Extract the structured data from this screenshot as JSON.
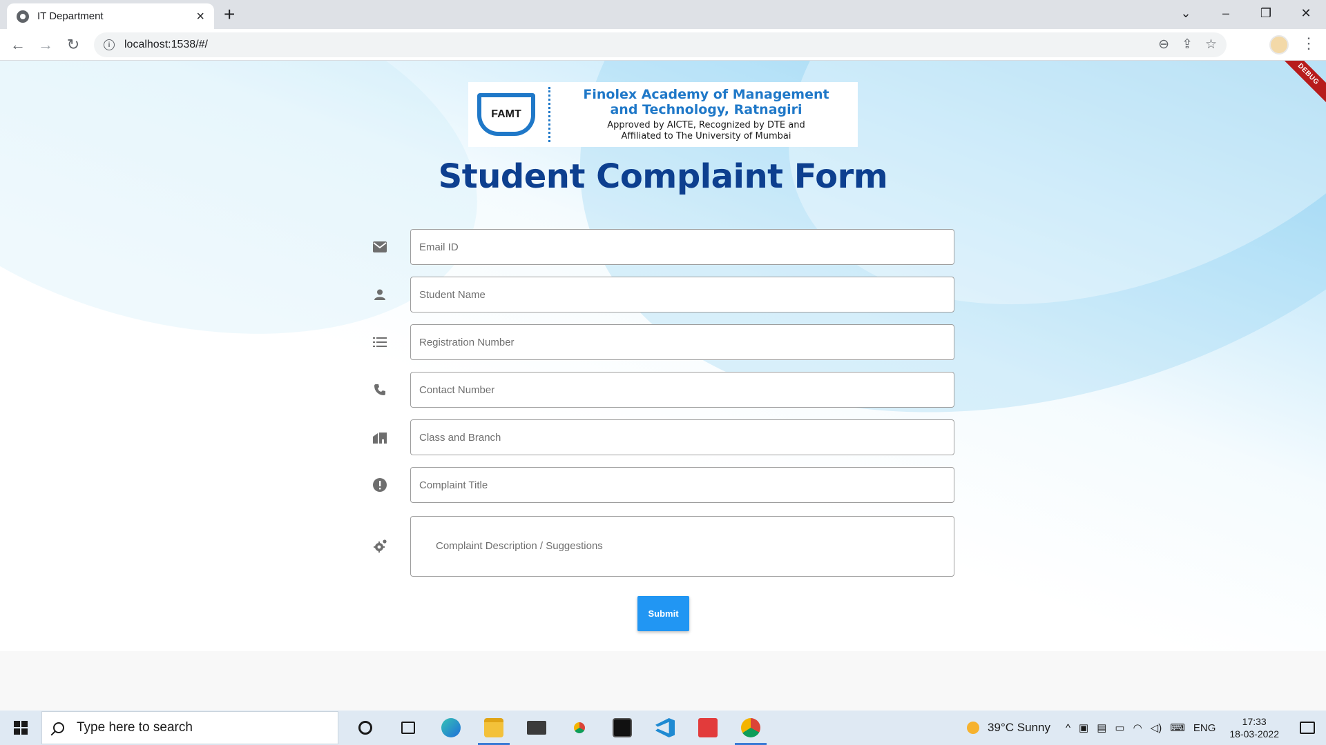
{
  "browser": {
    "tab_title": "IT Department",
    "url": "localhost:1538/#/"
  },
  "app": {
    "debug_label": "DEBUG",
    "logo": {
      "badge": "FAMT",
      "line1a": "Finolex Academy of Management",
      "line1b": "and Technology, Ratnagiri",
      "line2a": "Approved by AICTE, Recognized by DTE and",
      "line2b": "Affiliated to The University of Mumbai"
    },
    "title": "Student Complaint Form",
    "fields": {
      "email": "Email ID",
      "name": "Student Name",
      "registration": "Registration Number",
      "contact": "Contact Number",
      "class_branch": "Class and Branch",
      "complaint_title": "Complaint Title",
      "description": "Complaint Description / Suggestions"
    },
    "submit_label": "Submit"
  },
  "taskbar": {
    "search_placeholder": "Type here to search",
    "weather": "39°C  Sunny",
    "lang": "ENG",
    "time": "17:33",
    "date": "18-03-2022"
  }
}
